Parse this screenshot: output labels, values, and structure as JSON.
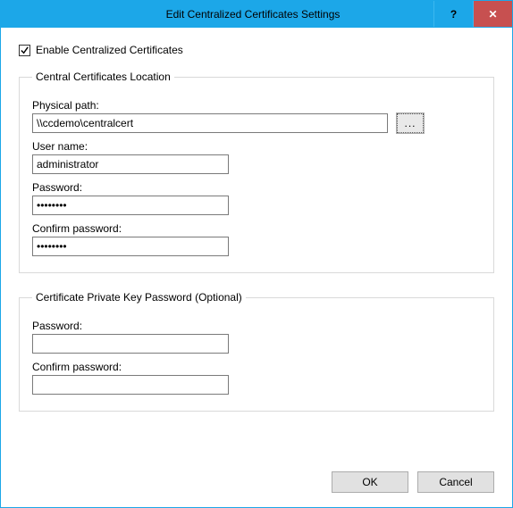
{
  "window": {
    "title": "Edit Centralized Certificates Settings",
    "help_label": "?",
    "close_label": "✕"
  },
  "enable": {
    "label": "Enable Centralized Certificates",
    "checked": true
  },
  "group1": {
    "legend": "Central Certificates Location",
    "physical_path_label": "Physical path:",
    "physical_path_value": "\\\\ccdemo\\centralcert",
    "browse_label": "...",
    "username_label": "User name:",
    "username_value": "administrator",
    "password_label": "Password:",
    "password_value": "••••••••",
    "confirm_label": "Confirm password:",
    "confirm_value": "••••••••"
  },
  "group2": {
    "legend": "Certificate Private Key Password (Optional)",
    "password_label": "Password:",
    "password_value": "",
    "confirm_label": "Confirm password:",
    "confirm_value": ""
  },
  "buttons": {
    "ok": "OK",
    "cancel": "Cancel"
  }
}
